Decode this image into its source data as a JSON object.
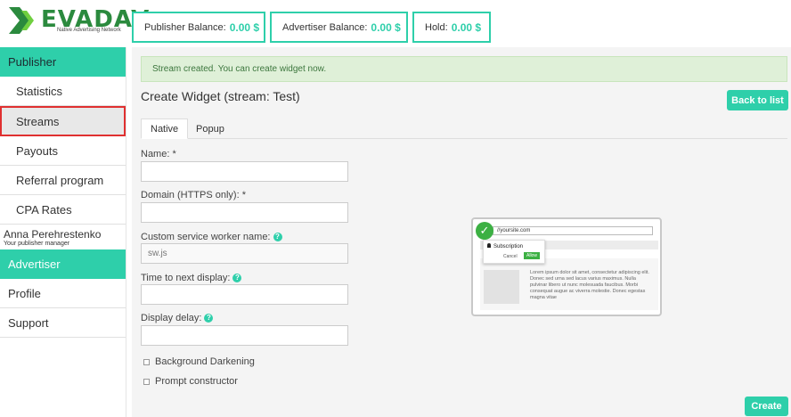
{
  "brand": {
    "name": "EVADAV",
    "tagline": "Native Advertising Network",
    "color": "#2b8a3e"
  },
  "balances": [
    {
      "label": "Publisher Balance:",
      "value": "0.00 $"
    },
    {
      "label": "Advertiser Balance:",
      "value": "0.00 $"
    },
    {
      "label": "Hold:",
      "value": "0.00 $"
    }
  ],
  "sidebar": {
    "publisher_label": "Publisher",
    "items": [
      {
        "label": "Statistics"
      },
      {
        "label": "Streams"
      },
      {
        "label": "Payouts"
      },
      {
        "label": "Referral program"
      },
      {
        "label": "CPA Rates"
      }
    ],
    "manager": {
      "name": "Anna Perehrestenko",
      "role": "Your publisher manager"
    },
    "advertiser_label": "Advertiser",
    "bottom_items": [
      {
        "label": "Profile"
      },
      {
        "label": "Support"
      }
    ]
  },
  "main": {
    "alert": "Stream created. You can create widget now.",
    "title": "Create Widget (stream: Test)",
    "back_button": "Back to list",
    "tabs": [
      {
        "label": "Native"
      },
      {
        "label": "Popup"
      }
    ],
    "fields": {
      "name_label": "Name: *",
      "name_value": "",
      "domain_label": "Domain (HTTPS only): *",
      "domain_value": "",
      "sw_label": "Custom service worker name:",
      "sw_value": "sw.js",
      "time_label": "Time to next display:",
      "time_value": "",
      "delay_label": "Display delay:",
      "delay_value": ""
    },
    "checkboxes": [
      {
        "label": "Background Darkening"
      },
      {
        "label": "Prompt constructor"
      }
    ],
    "create_button": "Create",
    "help_glyph": "?"
  },
  "preview": {
    "url": "//yoursite.com",
    "check_glyph": "✓",
    "popup_title": "Subscription",
    "cancel": "Cancel",
    "allow": "Allow",
    "text": "Lorem ipsum dolor sit amet, consectetur adipiscing elit. Donec sed urna sed lacus varius maximus. Nulla pulvinar libero ut nunc molesuada faucibus. Morbi consequat augue ac viverra molestie. Donec egestas magna vitae"
  },
  "colors": {
    "accent": "#2ecfaa",
    "alert_bg": "#dff0d8",
    "active_outline": "#e03030"
  }
}
